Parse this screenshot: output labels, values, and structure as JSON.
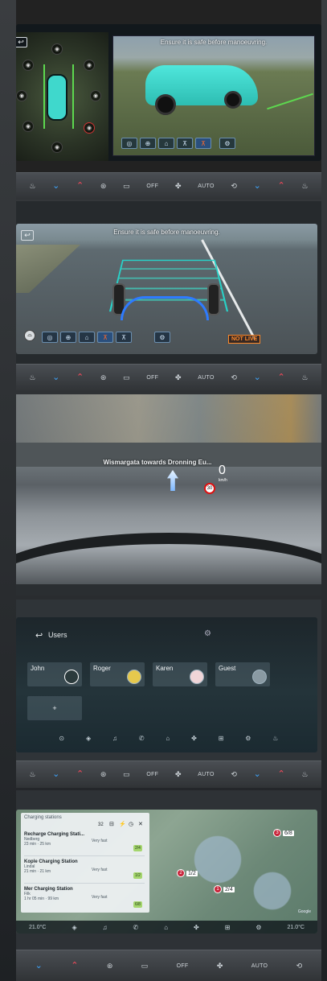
{
  "panel1": {
    "banner": "Ensure it is safe before manoeuvring.",
    "back_icon": "back-arrow-icon",
    "toolbar": [
      "360-view-icon",
      "top-view-icon",
      "front-view-icon",
      "car-side-icon",
      "car-red-icon"
    ],
    "settings_icon": "gear-icon"
  },
  "hvac1": [
    "seat-heat-icon",
    "⌄",
    "⌃",
    "defrost-front-icon",
    "defrost-rear-icon",
    "OFF",
    "fan-icon",
    "AUTO",
    "recirculate-icon",
    "⌄",
    "⌃",
    "seat-heat-icon"
  ],
  "panel2": {
    "banner": "Ensure it is safe before manoeuvring.",
    "not_live": "NOT LIVE"
  },
  "hvac2": [
    "seat-heat-icon",
    "⌄",
    "⌃",
    "defrost-front-icon",
    "defrost-rear-icon",
    "OFF",
    "fan-icon",
    "AUTO",
    "recirculate-icon",
    "⌄",
    "⌃",
    "seat-heat-icon"
  ],
  "hud": {
    "street": "Wismargata towards Dronning Eu...",
    "speed": "0",
    "speed_unit": "km/h",
    "speed_limit": "30"
  },
  "users": {
    "title": "Users",
    "cards": [
      {
        "name": "John"
      },
      {
        "name": "Roger"
      },
      {
        "name": "Karen"
      },
      {
        "name": "Guest"
      }
    ],
    "add_label": "+"
  },
  "hvac3": [
    "seat-heat-icon",
    "⌄",
    "⌃",
    "defrost-front-icon",
    "defrost-rear-icon",
    "OFF",
    "fan-icon",
    "AUTO",
    "recirculate-icon",
    "⌄",
    "⌃",
    "seat-heat-icon"
  ],
  "charging": {
    "title": "Charging stations",
    "count": "32",
    "stations": [
      {
        "num": "1",
        "name": "Recharge Charging Stati...",
        "place": "Nedberg",
        "time": "23 min · 25 km",
        "speed": "Very fast",
        "avail": "2/4"
      },
      {
        "num": "2",
        "name": "Kople Charging Station",
        "place": "Lindal",
        "time": "21 min · 21 km",
        "speed": "Very fast",
        "avail": "1/2"
      },
      {
        "num": "3",
        "name": "Mer Charging Station",
        "place": "Filk",
        "time": "1 hr 05 min · 99 km",
        "speed": "Very fast",
        "avail": "6/8"
      }
    ],
    "pins": [
      {
        "num": "3",
        "label": "6/8"
      },
      {
        "num": "2",
        "label": "1/2"
      },
      {
        "num": "1",
        "label": "2/4"
      }
    ],
    "temp_left": "21.0°C",
    "temp_right": "21.0°C",
    "map_credit": "Google"
  },
  "hvac4": [
    "⌄",
    "⌃",
    "defrost-front-icon",
    "defrost-rear-icon",
    "OFF",
    "fan-icon",
    "AUTO",
    "recirculate-icon"
  ]
}
